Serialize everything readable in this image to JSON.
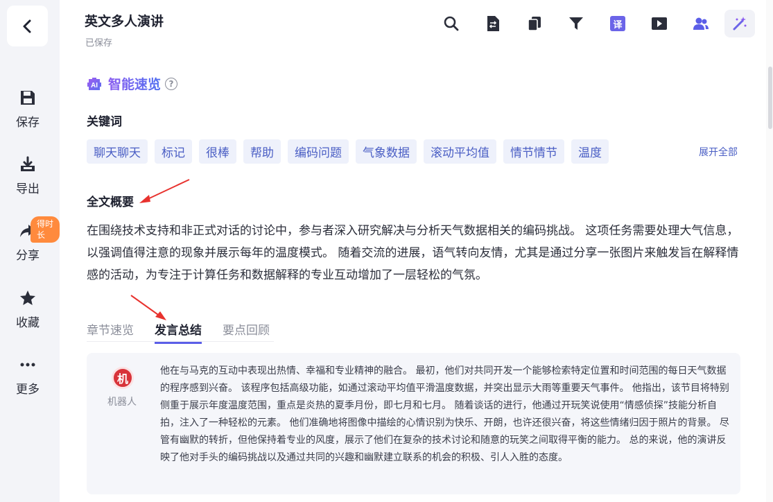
{
  "sidebar": {
    "items": [
      {
        "label": "保存",
        "icon": "save-icon"
      },
      {
        "label": "导出",
        "icon": "export-icon"
      },
      {
        "label": "分享",
        "icon": "share-icon"
      },
      {
        "label": "收藏",
        "icon": "star-icon"
      },
      {
        "label": "更多",
        "icon": "more-icon"
      }
    ],
    "badge": "得时长"
  },
  "header": {
    "title": "英文多人演讲",
    "status": "已保存",
    "toolbar": {
      "translate_label": "译",
      "icons": [
        "search-icon",
        "document-swap-icon",
        "copy-icon",
        "filter-icon",
        "translate-icon",
        "play-icon",
        "users-icon",
        "magic-wand-icon"
      ]
    }
  },
  "overview": {
    "title": "智能速览",
    "ai_badge": "AI",
    "help": "?",
    "keywords_title": "关键词",
    "keywords": [
      "聊天聊天",
      "标记",
      "很棒",
      "帮助",
      "编码问题",
      "气象数据",
      "滚动平均值",
      "情节情节",
      "温度"
    ],
    "expand_all": "展开全部",
    "summary_title": "全文概要",
    "summary_text": "在围绕技术支持和非正式对话的讨论中，参与者深入研究解决与分析天气数据相关的编码挑战。 这项任务需要处理大气信息，以强调值得注意的现象并展示每年的温度模式。 随着交流的进展，语气转向友情，尤其是通过分享一张图片来触发旨在解释情感的活动，为专注于计算任务和数据解释的专业互动增加了一层轻松的气氛。"
  },
  "tabs": [
    {
      "label": "章节速览",
      "active": false
    },
    {
      "label": "发言总结",
      "active": true
    },
    {
      "label": "要点回顾",
      "active": false
    }
  ],
  "speaker": {
    "avatar_text": "机",
    "name": "机器人",
    "text": "他在与马克的互动中表现出热情、幸福和专业精神的融合。 最初，他们对共同开发一个能够检索特定位置和时间范围的每日天气数据的程序感到兴奋。 该程序包括高级功能，如通过滚动平均值平滑温度数据，并突出显示大雨等重要天气事件。 他指出，该节目将特别侧重于展示年度温度范围，重点是炎热的夏季月份，即七月和七月。 随着谈话的进行，他通过开玩笑说使用“情感侦探”技能分析自拍，注入了一种轻松的元素。 他们准确地将图像中描绘的心情识别为快乐、开朗，也许还很兴奋，将这些情绪归因于照片的背景。 尽管有幽默的转折，但他保持着专业的风度，展示了他们在复杂的技术讨论和随意的玩笑之间取得平衡的能力。 总的来说，他的演讲反映了他对手头的编码挑战以及通过共同的兴趣和幽默建立联系的机会的积极、引人入胜的态度。"
  },
  "colors": {
    "accent": "#5b5ee8",
    "keyword_bg": "#eef1fb",
    "keyword_text": "#4a5ec4",
    "badge": "#ff8a3d",
    "annotation_arrow": "#e8322e"
  }
}
